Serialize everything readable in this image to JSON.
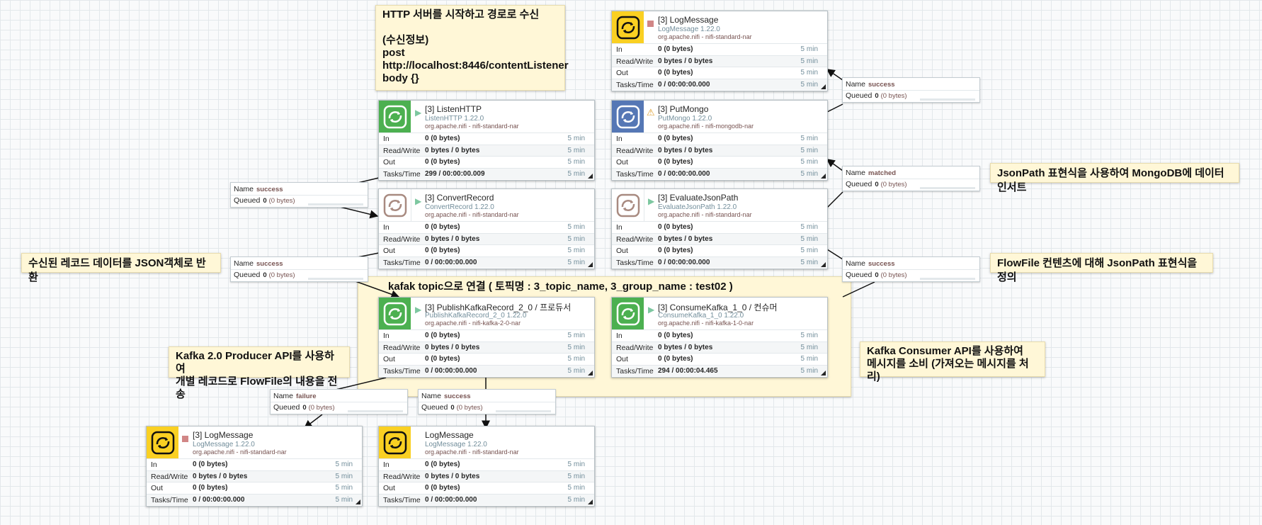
{
  "labels": [
    {
      "text": "HTTP 서버를 시작하고 경로로 수신\n\n(수신정보)\npost\nhttp://localhost:8446/contentListener\nbody {}"
    },
    {
      "text": "JsonPath 표현식을 사용하여 MongoDB에 데이터 인서트"
    },
    {
      "text": "수신된 레코드 데이터를 JSON객체로 반환"
    },
    {
      "text": "FlowFile 컨텐츠에 대해 JsonPath 표현식을 정의"
    },
    {
      "text": "kafak topic으로 연결 ( 토픽명 : 3_topic_name, 3_group_name : test02 )"
    },
    {
      "text": "Kafka 2.0 Producer API를 사용하여\n개별 레코드로 FlowFile의 내용을 전송"
    },
    {
      "text": "Kafka Consumer API를 사용하여\n메시지를 소비 (가져오는 메시지를 처리)"
    }
  ],
  "stat_labels": {
    "in": "In",
    "rw": "Read/Write",
    "out": "Out",
    "tasks": "Tasks/Time"
  },
  "processors": [
    {
      "title": "[3] LogMessage",
      "type": "LogMessage 1.22.0",
      "bundle": "org.apache.nifi - nifi-standard-nar",
      "in": "0 (0 bytes)",
      "rw": "0 bytes / 0 bytes",
      "out": "0 (0 bytes)",
      "tasks": "0 / 00:00:00.000",
      "period": "5 min",
      "color": "#fad022",
      "status": "stopped"
    },
    {
      "title": "[3] ListenHTTP",
      "type": "ListenHTTP 1.22.0",
      "bundle": "org.apache.nifi - nifi-standard-nar",
      "in": "0 (0 bytes)",
      "rw": "0 bytes / 0 bytes",
      "out": "0 (0 bytes)",
      "tasks": "299 / 00:00:00.009",
      "period": "5 min",
      "color": "#4cb050",
      "status": "running"
    },
    {
      "title": "[3] PutMongo",
      "type": "PutMongo 1.22.0",
      "bundle": "org.apache.nifi - nifi-mongodb-nar",
      "in": "0 (0 bytes)",
      "rw": "0 bytes / 0 bytes",
      "out": "0 (0 bytes)",
      "tasks": "0 / 00:00:00.000",
      "period": "5 min",
      "color": "#5577b5",
      "status": "warning"
    },
    {
      "title": "[3] ConvertRecord",
      "type": "ConvertRecord 1.22.0",
      "bundle": "org.apache.nifi - nifi-standard-nar",
      "in": "0 (0 bytes)",
      "rw": "0 bytes / 0 bytes",
      "out": "0 (0 bytes)",
      "tasks": "0 / 00:00:00.000",
      "period": "5 min",
      "color": "#ffffff",
      "status": "running"
    },
    {
      "title": "[3] EvaluateJsonPath",
      "type": "EvaluateJsonPath 1.22.0",
      "bundle": "org.apache.nifi - nifi-standard-nar",
      "in": "0 (0 bytes)",
      "rw": "0 bytes / 0 bytes",
      "out": "0 (0 bytes)",
      "tasks": "0 / 00:00:00.000",
      "period": "5 min",
      "color": "#ffffff",
      "status": "running"
    },
    {
      "title": "[3] PublishKafkaRecord_2_0 / 프로듀서",
      "type": "PublishKafkaRecord_2_0 1.22.0",
      "bundle": "org.apache.nifi - nifi-kafka-2-0-nar",
      "in": "0 (0 bytes)",
      "rw": "0 bytes / 0 bytes",
      "out": "0 (0 bytes)",
      "tasks": "0 / 00:00:00.000",
      "period": "5 min",
      "color": "#4cb050",
      "status": "running"
    },
    {
      "title": "[3] ConsumeKafka_1_0 / 컨슈머",
      "type": "ConsumeKafka_1_0 1.22.0",
      "bundle": "org.apache.nifi - nifi-kafka-1-0-nar",
      "in": "0 (0 bytes)",
      "rw": "0 bytes / 0 bytes",
      "out": "0 (0 bytes)",
      "tasks": "294 / 00:00:04.465",
      "period": "5 min",
      "color": "#4cb050",
      "status": "running"
    },
    {
      "title": "[3] LogMessage",
      "type": "LogMessage 1.22.0",
      "bundle": "org.apache.nifi - nifi-standard-nar",
      "in": "0 (0 bytes)",
      "rw": "0 bytes / 0 bytes",
      "out": "0 (0 bytes)",
      "tasks": "0 / 00:00:00.000",
      "period": "5 min",
      "color": "#fad022",
      "status": "stopped"
    },
    {
      "title": "LogMessage",
      "type": "LogMessage 1.22.0",
      "bundle": "org.apache.nifi - nifi-standard-nar",
      "in": "0 (0 bytes)",
      "rw": "0 bytes / 0 bytes",
      "out": "0 (0 bytes)",
      "tasks": "0 / 00:00:00.000",
      "period": "5 min",
      "color": "#fad022",
      "status": "none"
    }
  ],
  "connection_labels": {
    "name": "Name",
    "queued": "Queued"
  },
  "connections": [
    {
      "name": "success",
      "count": "0",
      "detail": "(0 bytes)"
    },
    {
      "name": "matched",
      "count": "0",
      "detail": "(0 bytes)"
    },
    {
      "name": "success",
      "count": "0",
      "detail": "(0 bytes)"
    },
    {
      "name": "success",
      "count": "0",
      "detail": "(0 bytes)"
    },
    {
      "name": "success",
      "count": "0",
      "detail": "(0 bytes)"
    },
    {
      "name": "failure",
      "count": "0",
      "detail": "(0 bytes)"
    },
    {
      "name": "success",
      "count": "0",
      "detail": "(0 bytes)"
    }
  ]
}
